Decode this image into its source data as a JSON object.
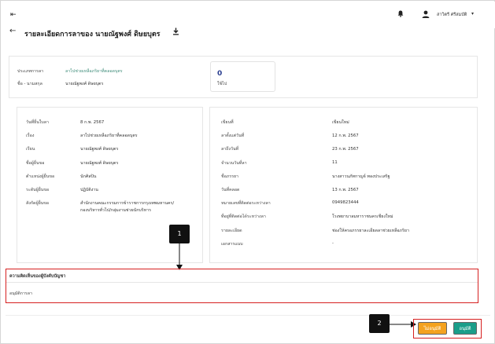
{
  "header": {
    "user_name": "สาวิตรี ศรีสมบัติ",
    "page_title": "รายละเอียดการลาของ นายณัฐพงศ์ ดิษยบุตร"
  },
  "summary": {
    "leave_type_label": "ประเภทการลา",
    "leave_type_value": "ลาไปช่วยเหลือภริยาที่คลอดบุตร",
    "name_label": "ชื่อ - นามสกุล",
    "name_value": "นายณัฐพงศ์ ดิษยบุตร",
    "count_value": "0",
    "count_unit": "ใช้ไป"
  },
  "left_details": [
    {
      "label": "วันที่ยื่นใบลา",
      "value": "8 ก.พ. 2567"
    },
    {
      "label": "เรื่อง",
      "value": "ลาไปช่วยเหลือภริยาที่คลอดบุตร"
    },
    {
      "label": "เรียน",
      "value": "นายณัฐพงศ์ ดิษยบุตร"
    },
    {
      "label": "ชื่อผู้ยื่นขอ",
      "value": "นายณัฐพงศ์ ดิษยบุตร"
    },
    {
      "label": "ตำแหน่งผู้ยื่นขอ",
      "value": "นักศิลปิน"
    },
    {
      "label": "ระดับผู้ยื่นขอ",
      "value": "ปฏิบัติงาน"
    },
    {
      "label": "สังกัดผู้ยื่นขอ",
      "value": "สำนักงานคณะกรรมการข้าราชการกรุงเทพมหานคร/",
      "value2": "กองบริหารทั่วไป/กลุ่มงานช่วยนักบริหาร"
    }
  ],
  "right_details": [
    {
      "label": "เขียนที่",
      "value": "เขียนใหม่"
    },
    {
      "label": "ลาตั้งแต่วันที่",
      "value": "12 ก.พ. 2567"
    },
    {
      "label": "ลาถึงวันที่",
      "value": "23 ก.พ. 2567"
    },
    {
      "label": "จำนวนวันที่ลา",
      "value": "11"
    },
    {
      "label": "ชื่อภรรยา",
      "value": "นางสาวนภัทกาญจ์ ทองประเสริฐ"
    },
    {
      "label": "วันที่คลอด",
      "value": "13 ก.พ. 2567"
    },
    {
      "label": "หมายเลขที่ติดต่อระหว่างลา",
      "value": "0949823444"
    },
    {
      "label": "ที่อยู่ที่ติดต่อได้ระหว่างลา",
      "value": "โรงพยาบาลมหาราชนครเชียงใหม่"
    },
    {
      "label": "รายละเอียด",
      "value": "ช่องให้ครอภรรยาละเอียดลาช่วยเหลือภริยา"
    },
    {
      "label": "เอกสารแนบ",
      "value": "-"
    }
  ],
  "comment": {
    "heading": "ความคิดเห็นของผู้บังคับบัญชา",
    "text": "อนุมัติการลา"
  },
  "callouts": {
    "one": "1",
    "two": "2"
  },
  "actions": {
    "reject_label": "ไม่อนุมัติ",
    "approve_label": "อนุมัติ"
  },
  "colors": {
    "title_accent": "#2b3f90",
    "reject": "#f4a21f",
    "approve": "#1a9e8a",
    "highlight": "#d62020"
  },
  "icons": {
    "menu": "collapse-sidebar-icon",
    "bell": "bell-icon",
    "user": "user-icon",
    "back": "back-arrow-icon",
    "download": "download-icon"
  }
}
